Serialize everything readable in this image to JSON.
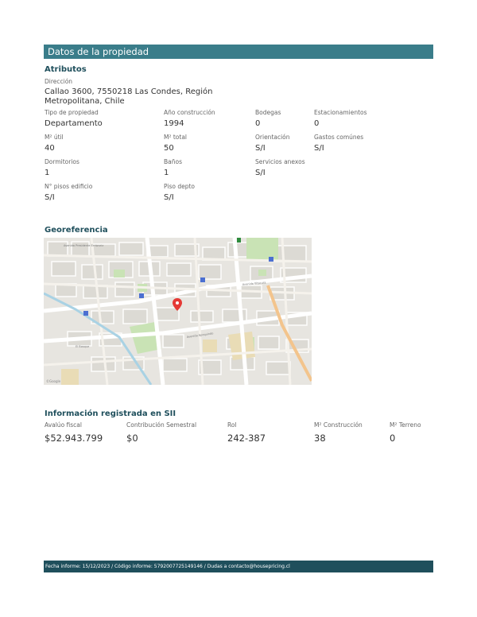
{
  "header": {
    "title": "Datos de la propiedad"
  },
  "attributes": {
    "section_title": "Atributos",
    "direccion_label": "Dirección",
    "direccion_value": "Callao 3600, 7550218 Las Condes, Región Metropolitana, Chile",
    "fields": [
      {
        "label": "Tipo de propiedad",
        "value": "Departamento"
      },
      {
        "label": "Año construcción",
        "value": "1994"
      },
      {
        "label": "Bodegas",
        "value": "0"
      },
      {
        "label": "Estacionamientos",
        "value": "0"
      },
      {
        "label": "M² útil",
        "value": "40"
      },
      {
        "label": "M² total",
        "value": "50"
      },
      {
        "label": "Orientación",
        "value": "S/I"
      },
      {
        "label": "Gastos comúnes",
        "value": "S/I"
      },
      {
        "label": "Dormitorios",
        "value": "1"
      },
      {
        "label": "Baños",
        "value": "1"
      },
      {
        "label": "Servicios anexos",
        "value": "S/I"
      },
      {
        "label": "N° pisos edificio",
        "value": "S/I"
      },
      {
        "label": "Piso depto",
        "value": "S/I"
      }
    ]
  },
  "georeferencia": {
    "section_title": "Georeferencia",
    "map_attribution": "©Google",
    "map_streets": [
      "Avenida Presidente Errázuriz",
      "Avenida Apoquindo",
      "Avenida Vitacura",
      "El Bosque"
    ]
  },
  "sii": {
    "section_title": "Información registrada en SII",
    "fields": [
      {
        "label": "Avalúo fiscal",
        "value": "$52.943.799"
      },
      {
        "label": "Contribución Semestral",
        "value": "$0"
      },
      {
        "label": "Rol",
        "value": "242-387"
      },
      {
        "label": "M² Construcción",
        "value": "38"
      },
      {
        "label": "M² Terreno",
        "value": "0"
      }
    ]
  },
  "footer": {
    "text": "Fecha informe: 15/12/2023 / Código informe: 5792007725149146 / Dudas a contacto@housepricing.cl"
  },
  "colors": {
    "header_bg": "#3a7d8a",
    "footer_bg": "#1f4f5c",
    "title_color": "#1f4f5c"
  }
}
